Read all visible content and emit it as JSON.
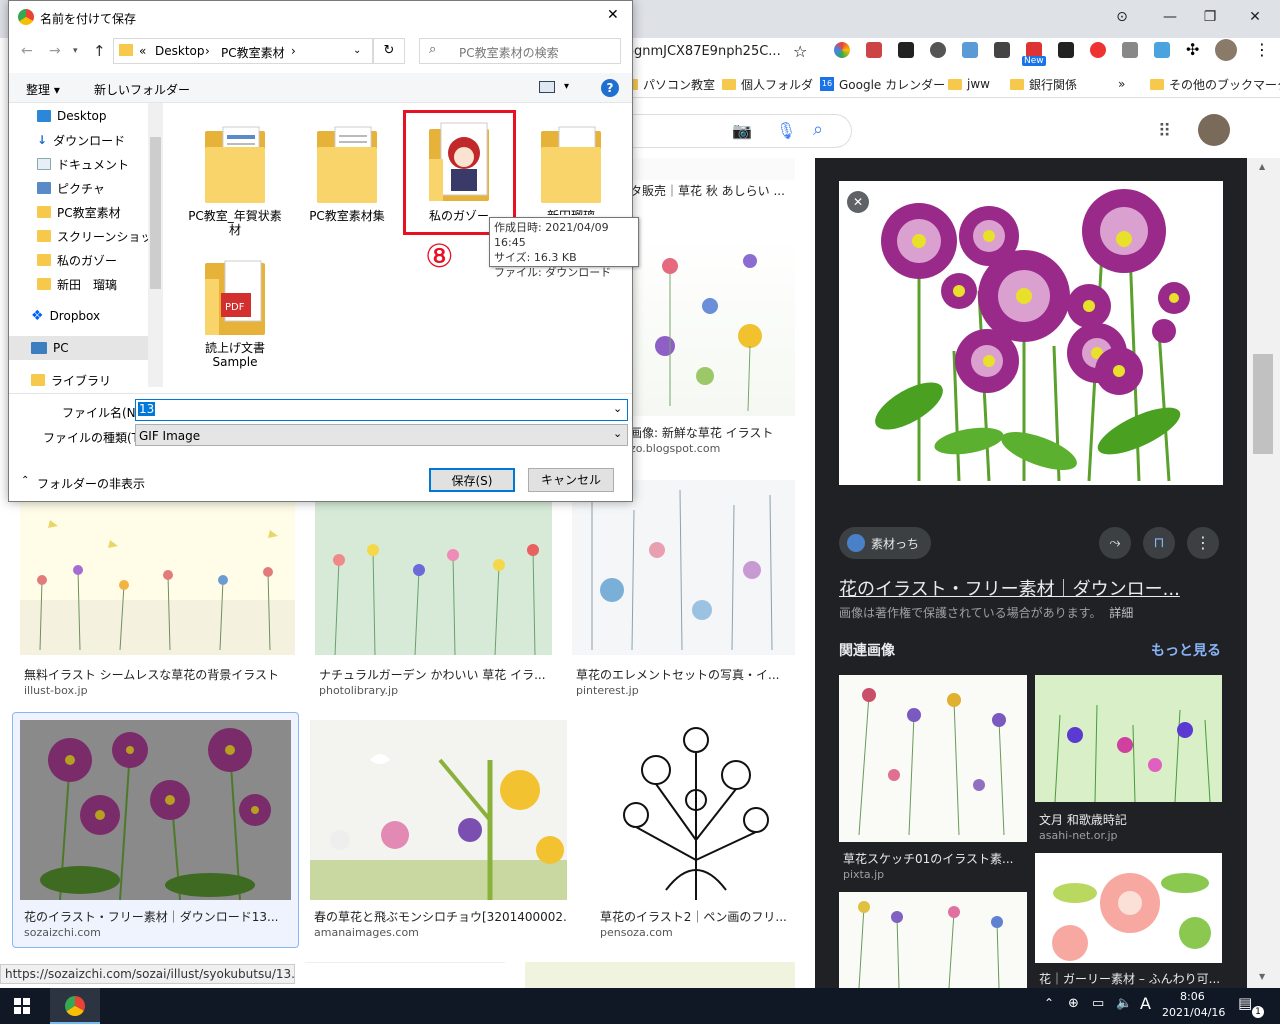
{
  "browser": {
    "omnibox_text": "ognmJCX87E9nph25C...",
    "bookmarks": [
      "パソコン教室",
      "個人フォルダ",
      "Google カレンダー",
      "jww",
      "銀行関係",
      "»",
      "その他のブックマーク"
    ],
    "calendar_badge": "16",
    "new_badge": "New"
  },
  "dialog": {
    "title": "名前を付けて保存",
    "breadcrumb": [
      "«",
      "Desktop",
      "›",
      "PC教室素材",
      "›"
    ],
    "search_placeholder": "PC教室素材の検索",
    "toolbar": {
      "organize": "整理 ▾",
      "new_folder": "新しいフォルダー",
      "help": "?"
    },
    "nav_items": [
      "Desktop",
      "ダウンロード",
      "ドキュメント",
      "ピクチャ",
      "PC教室素材",
      "スクリーンショット",
      "私のガゾー",
      "新田　瑠璃",
      "Dropbox",
      "PC",
      "ライブラリ"
    ],
    "files": [
      {
        "label": "PC教室_年賀状素\n材",
        "type": "folder"
      },
      {
        "label": "PC教室素材集",
        "type": "folder"
      },
      {
        "label": "私のガゾー",
        "type": "folder-image"
      },
      {
        "label": "新田瑠璃",
        "type": "folder"
      },
      {
        "label": "読上げ文書\nSample",
        "type": "folder-pdf"
      }
    ],
    "tooltip": [
      "作成日時: 2021/04/09 16:45",
      "サイズ: 16.3 KB",
      "ファイル: ダウンロード"
    ],
    "step_marker": "⑧",
    "filename_label": "ファイル名(N):",
    "filename_value": "13",
    "filetype_label": "ファイルの種類(T):",
    "filetype_value": "GIF Image",
    "hide_folders": "フォルダーの非表示",
    "save_button": "保存(S)",
    "cancel_button": "キャンセル"
  },
  "results": [
    {
      "title": "タ販売｜草花 秋 あしらい ...",
      "site": ""
    },
    {
      "title": "画像: 新鮮な草花 イラスト",
      "site": "zo.blogspot.com"
    },
    {
      "title": "無料イラスト シームレスな草花の背景イラスト",
      "site": "illust-box.jp"
    },
    {
      "title": "ナチュラルガーデン かわいい 草花 イラ...",
      "site": "photolibrary.jp"
    },
    {
      "title": "草花のエレメントセットの写真・イ...",
      "site": "pinterest.jp"
    },
    {
      "title": "花のイラスト・フリー素材｜ダウンロード13...",
      "site": "sozaizchi.com"
    },
    {
      "title": "春の草花と飛ぶモンシロチョウ[3201400002...",
      "site": "amanaimages.com"
    },
    {
      "title": "草花のイラスト2｜ペン画のフリ...",
      "site": "pensoza.com"
    }
  ],
  "panel": {
    "source": "素材っち",
    "title": "花のイラスト・フリー素材｜ダウンロー...",
    "copyright": "画像は著作権で保護されている場合があります。",
    "detail": "詳細",
    "related": "関連画像",
    "more": "もっと見る",
    "related_items": [
      {
        "title": "草花スケッチ01のイラスト素...",
        "site": "pixta.jp"
      },
      {
        "title": "文月 和歌歳時記",
        "site": "asahi-net.or.jp"
      },
      {
        "title": "花｜ガーリー素材 – ふんわり可...",
        "site": ""
      }
    ]
  },
  "status_url": "https://sozaizchi.com/sozai/illust/syokubutsu/13.html",
  "taskbar": {
    "time": "8:06",
    "date": "2021/04/16",
    "ime": "A",
    "notif": "1"
  },
  "colors": {
    "accent": "#0078d7",
    "highlight_box": "#e81123",
    "dark_panel": "#202124",
    "link_blue": "#8ab4f8"
  }
}
